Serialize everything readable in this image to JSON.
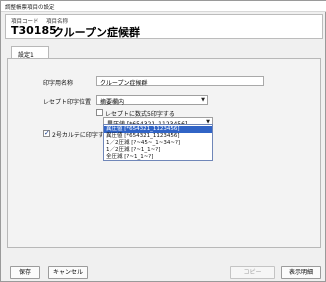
{
  "window": {
    "title": "調整帳票項目の設定"
  },
  "header": {
    "code_label": "項目コード",
    "name_label": "項目名称",
    "code": "T30185",
    "name": "クループン症候群"
  },
  "tabs": [
    {
      "label": "設定1"
    }
  ],
  "form": {
    "print_name_label": "印字用名称",
    "print_name_value": "クループン症候群",
    "receipt_position_label": "レセプト印字位置",
    "receipt_position_value": "摘要欄内",
    "receipt_cb_label": "レセプトに数式5印字する",
    "detail_select_value": "異圧値",
    "detail_select_code": "[*654321_1123456]",
    "karte_cb_label": "2号カルテに印字する",
    "dropdown_options": [
      {
        "label": "異圧値",
        "code": "[*654321_1123456]"
      },
      {
        "label": "異圧値",
        "code": "[*654321_1123456]"
      },
      {
        "label": "1／2圧減",
        "code": "[?~45~_1~34~?]"
      },
      {
        "label": "1／2圧減",
        "code": "[?~1_1~?]"
      },
      {
        "label": "全圧減",
        "code": "[?~1_1~?]"
      }
    ]
  },
  "footer": {
    "save_label": "保存",
    "cancel_label": "キャンセル",
    "copy_label": "コピー",
    "example_label": "表示明細"
  }
}
